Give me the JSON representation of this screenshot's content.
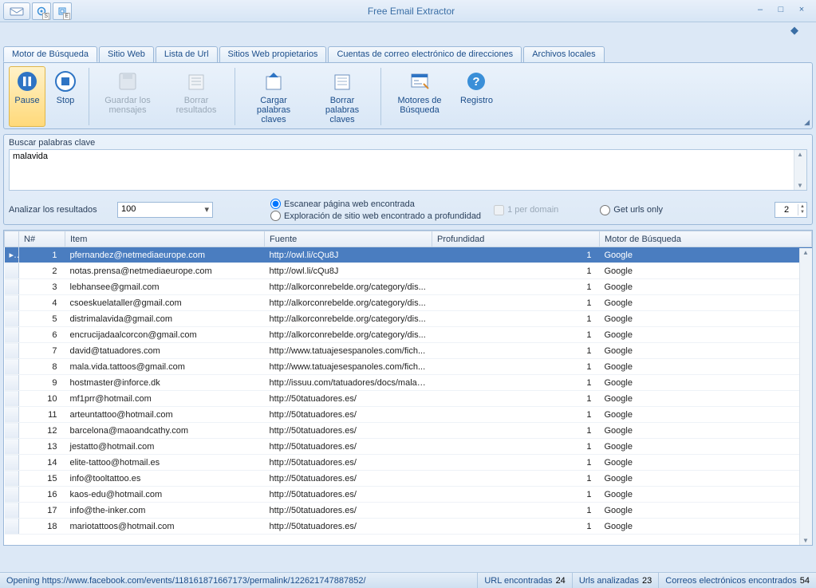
{
  "app": {
    "title": "Free Email Extractor"
  },
  "tabs": {
    "t0": "Motor de Búsqueda",
    "t1": "Sitio Web",
    "t2": "Lista de Url",
    "t3": "Sitios Web propietarios",
    "t4": "Cuentas de correo electrónico de direcciones",
    "t5": "Archivos locales"
  },
  "ribbon": {
    "pause": "Pause",
    "stop": "Stop",
    "save_msgs": "Guardar los mensajes",
    "clear_results": "Borrar resultados",
    "load_keywords": "Cargar palabras claves",
    "clear_keywords": "Borrar palabras claves",
    "search_engines": "Motores de Búsqueda",
    "log": "Registro"
  },
  "search": {
    "label": "Buscar palabras clave",
    "value": "malavida"
  },
  "options": {
    "analyze_label": "Analizar los resultados",
    "combo_value": "100",
    "scan_found": "Escanear página web encontrada",
    "explore_site": "Exploración de sitio web encontrado a profundidad",
    "per_domain": "1 per domain",
    "get_urls_only": "Get urls only",
    "depth_value": "2"
  },
  "grid": {
    "headers": {
      "n": "N#",
      "item": "Item",
      "fuente": "Fuente",
      "prof": "Profundidad",
      "motor": "Motor de Búsqueda"
    },
    "rows": [
      {
        "n": 1,
        "item": "pfernandez@netmediaeurope.com",
        "fuente": "http://owl.li/cQu8J",
        "prof": 1,
        "motor": "Google"
      },
      {
        "n": 2,
        "item": "notas.prensa@netmediaeurope.com",
        "fuente": "http://owl.li/cQu8J",
        "prof": 1,
        "motor": "Google"
      },
      {
        "n": 3,
        "item": "lebhansee@gmail.com",
        "fuente": "http://alkorconrebelde.org/category/dis...",
        "prof": 1,
        "motor": "Google"
      },
      {
        "n": 4,
        "item": "csoeskuelataller@gmail.com",
        "fuente": "http://alkorconrebelde.org/category/dis...",
        "prof": 1,
        "motor": "Google"
      },
      {
        "n": 5,
        "item": "distrimalavida@gmail.com",
        "fuente": "http://alkorconrebelde.org/category/dis...",
        "prof": 1,
        "motor": "Google"
      },
      {
        "n": 6,
        "item": "encrucijadaalcorcon@gmail.com",
        "fuente": "http://alkorconrebelde.org/category/dis...",
        "prof": 1,
        "motor": "Google"
      },
      {
        "n": 7,
        "item": "david@tatuadores.com",
        "fuente": "http://www.tatuajesespanoles.com/fich...",
        "prof": 1,
        "motor": "Google"
      },
      {
        "n": 8,
        "item": "mala.vida.tattoos@gmail.com",
        "fuente": "http://www.tatuajesespanoles.com/fich...",
        "prof": 1,
        "motor": "Google"
      },
      {
        "n": 9,
        "item": "hostmaster@inforce.dk",
        "fuente": "http://issuu.com/tatuadores/docs/malav...",
        "prof": 1,
        "motor": "Google"
      },
      {
        "n": 10,
        "item": "mf1prr@hotmail.com",
        "fuente": "http://50tatuadores.es/",
        "prof": 1,
        "motor": "Google"
      },
      {
        "n": 11,
        "item": "arteuntattoo@hotmail.com",
        "fuente": "http://50tatuadores.es/",
        "prof": 1,
        "motor": "Google"
      },
      {
        "n": 12,
        "item": "barcelona@maoandcathy.com",
        "fuente": "http://50tatuadores.es/",
        "prof": 1,
        "motor": "Google"
      },
      {
        "n": 13,
        "item": "jestatto@hotmail.com",
        "fuente": "http://50tatuadores.es/",
        "prof": 1,
        "motor": "Google"
      },
      {
        "n": 14,
        "item": "elite-tattoo@hotmail.es",
        "fuente": "http://50tatuadores.es/",
        "prof": 1,
        "motor": "Google"
      },
      {
        "n": 15,
        "item": "info@tooltattoo.es",
        "fuente": "http://50tatuadores.es/",
        "prof": 1,
        "motor": "Google"
      },
      {
        "n": 16,
        "item": "kaos-edu@hotmail.com",
        "fuente": "http://50tatuadores.es/",
        "prof": 1,
        "motor": "Google"
      },
      {
        "n": 17,
        "item": "info@the-inker.com",
        "fuente": "http://50tatuadores.es/",
        "prof": 1,
        "motor": "Google"
      },
      {
        "n": 18,
        "item": "mariotattoos@hotmail.com",
        "fuente": "http://50tatuadores.es/",
        "prof": 1,
        "motor": "Google"
      }
    ]
  },
  "status": {
    "opening": "Opening https://www.facebook.com/events/118161871667173/permalink/122621747887852/",
    "url_found_label": "URL encontradas",
    "url_found": "24",
    "url_analyzed_label": "Urls analizadas",
    "url_analyzed": "23",
    "emails_label": "Correos electrónicos encontrados",
    "emails": "54"
  }
}
